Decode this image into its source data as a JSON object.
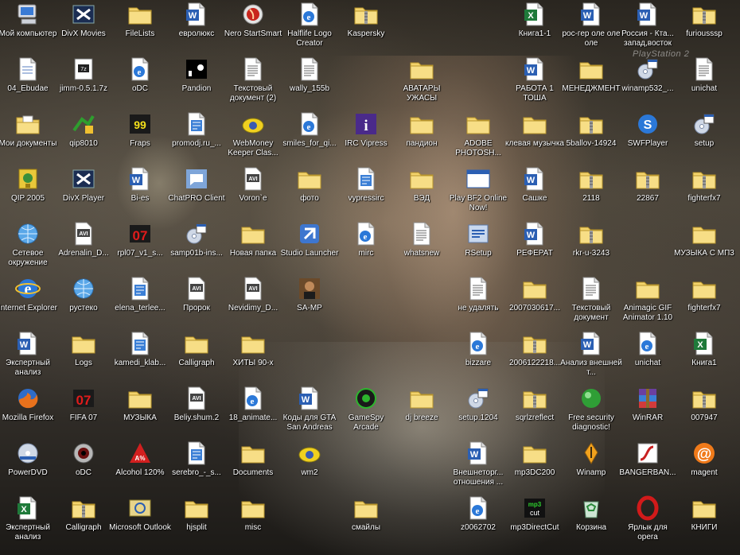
{
  "wallpaper": {
    "watermark": "PlayStation 2"
  },
  "colors": {
    "label_text": "#ffffff",
    "folder": "#f3d36b",
    "word_blue": "#2b5fb3",
    "excel_green": "#1f7a3a"
  },
  "icons": [
    {
      "label": "Мой компьютер",
      "type": "computer"
    },
    {
      "label": "04_Ebudae",
      "type": "document"
    },
    {
      "label": "Мои документы",
      "type": "mydocs"
    },
    {
      "label": "QIP 2005",
      "type": "qip"
    },
    {
      "label": "Сетевое окружение",
      "type": "network"
    },
    {
      "label": "Internet Explorer",
      "type": "ie"
    },
    {
      "label": "Экспертный анализ",
      "type": "word"
    },
    {
      "label": "Mozilla Firefox",
      "type": "firefox"
    },
    {
      "label": "PowerDVD",
      "type": "dvd"
    },
    {
      "label": "Экспертный анализ",
      "type": "excel"
    },
    {
      "label": "DivX Movies",
      "type": "divx"
    },
    {
      "label": "jimm-0.5.1.7z",
      "type": "archive"
    },
    {
      "label": "qip8010",
      "type": "qipinst"
    },
    {
      "label": "DivX Player",
      "type": "divx"
    },
    {
      "label": "Adrenalin_D...",
      "type": "avi"
    },
    {
      "label": "рустеко",
      "type": "network"
    },
    {
      "label": "Logs",
      "type": "folder"
    },
    {
      "label": "FIFA 07",
      "type": "game07"
    },
    {
      "label": "oDC",
      "type": "eye"
    },
    {
      "label": "Calligraph",
      "type": "zipfolder"
    },
    {
      "label": "FileLists",
      "type": "folder"
    },
    {
      "label": "oDC",
      "type": "html"
    },
    {
      "label": "Fraps",
      "type": "fraps"
    },
    {
      "label": "Bi-es",
      "type": "word"
    },
    {
      "label": "rpl07_v1_s...",
      "type": "game07"
    },
    {
      "label": "elena_terlee...",
      "type": "setup"
    },
    {
      "label": "kamedi_klab...",
      "type": "setup"
    },
    {
      "label": "МУЗЫКА",
      "type": "folder"
    },
    {
      "label": "Alcohol 120%",
      "type": "alcohol"
    },
    {
      "label": "Microsoft Outlook",
      "type": "outlook"
    },
    {
      "label": "евролюкс",
      "type": "word"
    },
    {
      "label": "Pandion",
      "type": "pandion"
    },
    {
      "label": "promodj.ru_...",
      "type": "setup"
    },
    {
      "label": "ChatPRO Client",
      "type": "chatpro"
    },
    {
      "label": "samp01b-ins...",
      "type": "setupcd"
    },
    {
      "label": "Пророк",
      "type": "avi"
    },
    {
      "label": "Calligraph",
      "type": "folder"
    },
    {
      "label": "Beliy.shum.2",
      "type": "avi"
    },
    {
      "label": "serebro_-_s...",
      "type": "setup"
    },
    {
      "label": "hjsplit",
      "type": "folder"
    },
    {
      "label": "Nero StartSmart",
      "type": "nero"
    },
    {
      "label": "Текстовый документ (2)",
      "type": "text"
    },
    {
      "label": "WebMoney Keeper Clas...",
      "type": "webmoney"
    },
    {
      "label": "Voron`e",
      "type": "avi"
    },
    {
      "label": "Новая папка",
      "type": "folder"
    },
    {
      "label": "Nevidimy_D...",
      "type": "avi"
    },
    {
      "label": "ХИТЫ 90-х",
      "type": "folder"
    },
    {
      "label": "18_animate...",
      "type": "html"
    },
    {
      "label": "Documents",
      "type": "folder"
    },
    {
      "label": "misc",
      "type": "folder"
    },
    {
      "label": "Halflife Logo Creator",
      "type": "html"
    },
    {
      "label": "wally_155b",
      "type": "text"
    },
    {
      "label": "smiles_for_qi...",
      "type": "html"
    },
    {
      "label": "фото",
      "type": "folder"
    },
    {
      "label": "Studio Launcher",
      "type": "studio"
    },
    {
      "label": "SA-MP",
      "type": "samp"
    },
    {
      "label": "Коды для GTA San Andreas",
      "type": "word"
    },
    {
      "label": "wm2",
      "type": "webmoney"
    },
    {
      "label": "Kaspersky",
      "type": "zipfolder"
    },
    {
      "label": "IRC Vipress",
      "type": "irc"
    },
    {
      "label": "vypressirc",
      "type": "setup"
    },
    {
      "label": "mirc",
      "type": "html"
    },
    {
      "label": "GameSpy Arcade",
      "type": "gamespy"
    },
    {
      "label": "смайлы",
      "type": "folder"
    },
    {
      "label": "АВАТАРЫ УЖАСЫ",
      "type": "folder"
    },
    {
      "label": "пандион",
      "type": "folder"
    },
    {
      "label": "ВЭД",
      "type": "folder"
    },
    {
      "label": "whatsnew",
      "type": "text"
    },
    {
      "label": "dj breeze",
      "type": "folder"
    },
    {
      "label": "ADOBE PHOTOSH...",
      "type": "folder"
    },
    {
      "label": "Play BF2 Online Now!",
      "type": "window"
    },
    {
      "label": "RSetup",
      "type": "rsetup"
    },
    {
      "label": "не удалять",
      "type": "text"
    },
    {
      "label": "bizzare",
      "type": "html"
    },
    {
      "label": "setup.1204",
      "type": "setupcd"
    },
    {
      "label": "Внешнеторг... отношения ...",
      "type": "word"
    },
    {
      "label": "z0062702",
      "type": "html"
    },
    {
      "label": "РАБОТА 1 ТОША",
      "type": "word"
    },
    {
      "label": "клевая музычка",
      "type": "folder"
    },
    {
      "label": "Сашке",
      "type": "word"
    },
    {
      "label": "РЕФЕРАТ",
      "type": "word"
    },
    {
      "label": "2007030617...",
      "type": "folder"
    },
    {
      "label": "2006122218...",
      "type": "zipfolder"
    },
    {
      "label": "sqrlzreflect",
      "type": "zipfolder"
    },
    {
      "label": "mp3DC200",
      "type": "folder"
    },
    {
      "label": "mp3DirectCut",
      "type": "mp3cut"
    },
    {
      "label": "Книга1-1",
      "type": "excel"
    },
    {
      "label": "МЕНЕДЖМЕНТ",
      "type": "folder"
    },
    {
      "label": "5ballov-14924",
      "type": "zipfolder"
    },
    {
      "label": "2118",
      "type": "zipfolder"
    },
    {
      "label": "rkr-u-3243",
      "type": "zipfolder"
    },
    {
      "label": "Текстовый документ",
      "type": "text"
    },
    {
      "label": "Анализ внешней т...",
      "type": "word"
    },
    {
      "label": "Free security diagnostic!",
      "type": "security"
    },
    {
      "label": "Winamp",
      "type": "winamp"
    },
    {
      "label": "Корзина",
      "type": "recycle"
    },
    {
      "label": "рос-гер оле оле оле",
      "type": "word"
    },
    {
      "label": "winamp532_...",
      "type": "setupcd"
    },
    {
      "label": "SWFPlayer",
      "type": "swf"
    },
    {
      "label": "22867",
      "type": "zipfolder"
    },
    {
      "label": "Animagic GIF Animator 1.10",
      "type": "folder"
    },
    {
      "label": "unichat",
      "type": "html"
    },
    {
      "label": "WinRAR",
      "type": "winrar"
    },
    {
      "label": "BANGERBAN...",
      "type": "flash"
    },
    {
      "label": "Ярлык для opera",
      "type": "opera"
    },
    {
      "label": "Россия - Кта... запад,восток",
      "type": "word"
    },
    {
      "label": "unichat",
      "type": "text"
    },
    {
      "label": "setup",
      "type": "setupcd"
    },
    {
      "label": "fighterfx7",
      "type": "zipfolder"
    },
    {
      "label": "МУЗЫКА С МП3",
      "type": "folder"
    },
    {
      "label": "fighterfx7",
      "type": "folder"
    },
    {
      "label": "Книга1",
      "type": "excel"
    },
    {
      "label": "007947",
      "type": "zipfolder"
    },
    {
      "label": "magent",
      "type": "magent"
    },
    {
      "label": "КНИГИ",
      "type": "folder"
    },
    {
      "label": "furiousssp",
      "type": "zipfolder"
    }
  ]
}
